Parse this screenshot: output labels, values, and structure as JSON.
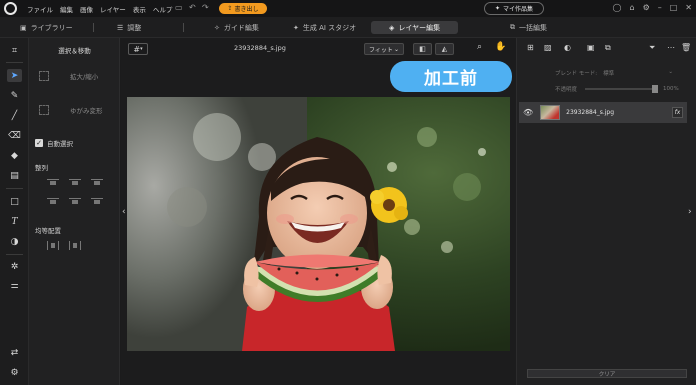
{
  "menubar": {
    "items": [
      "ファイル",
      "編集",
      "画像",
      "レイヤー",
      "表示",
      "ヘルプ"
    ],
    "export_label": "書き出し",
    "mywork_label": "マイ作品集"
  },
  "tabs": {
    "library": "ライブラリー",
    "adjust": "調整",
    "guide": "ガイド編集",
    "ai_studio": "生成 AI スタジオ",
    "layer_edit": "レイヤー編集",
    "batch_edit": "一括編集"
  },
  "toolpanel": {
    "title": "選択＆移動",
    "scale_label": "拡大/縮小",
    "warp_label": "ゆがみ変形",
    "auto_select_label": "自動選択",
    "align_label": "整列",
    "distribute_label": "均等配置"
  },
  "canvas": {
    "filename": "23932884_s.jpg",
    "fit_label": "フィット",
    "before_badge": "加工前"
  },
  "layers": {
    "blend_label": "ブレンド モード:",
    "blend_value": "標準",
    "opacity_label": "不透明度",
    "opacity_value": "100%",
    "layer_name": "23932884_s.jpg",
    "fx_label": "fx",
    "clear_label": "クリア"
  },
  "colors": {
    "accent_orange": "#f29a1f",
    "badge_blue": "#4fb0f2",
    "active_tool_blue": "#5ea8ff"
  }
}
